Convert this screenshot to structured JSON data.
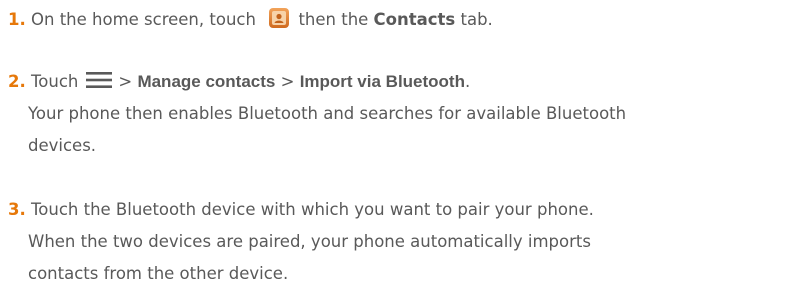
{
  "steps": [
    {
      "number": "1.",
      "text_before": "On the home screen, touch",
      "icon": "contacts-app-icon",
      "text_middle": "then the",
      "bold": "Contacts",
      "text_after": "tab."
    },
    {
      "number": "2.",
      "text_before": "Touch",
      "icon": "menu-icon",
      "sep1": ">",
      "bold1": "Manage contacts",
      "sep2": ">",
      "bold2": "Import via Bluetooth",
      "end": ".",
      "continuation": [
        "Your phone then enables Bluetooth and searches for available Bluetooth",
        "devices."
      ]
    },
    {
      "number": "3.",
      "lines": [
        "Touch the Bluetooth device with which you want to pair your phone.",
        "When the two devices are paired, your phone automatically imports",
        "contacts from the other device."
      ]
    }
  ],
  "colors": {
    "step_number": "#e6780a",
    "body_text": "#595959",
    "icon_orange": "#d06a1e"
  }
}
